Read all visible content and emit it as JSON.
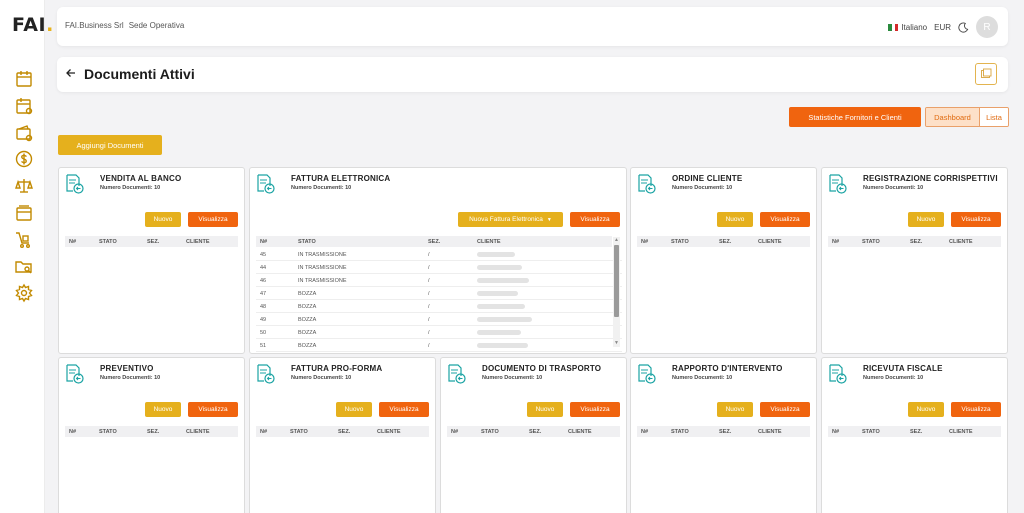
{
  "logo": {
    "text": "FAI",
    "dot": "."
  },
  "topbar": {
    "company": "FAI.Business Srl",
    "location": "Sede Operativa",
    "language": "Italiano",
    "currency": "EUR",
    "avatar_initial": "R"
  },
  "title": {
    "text": "Documenti Attivi"
  },
  "actions": {
    "stats_label": "Statistiche Fornitori e Clienti",
    "dashboard_label": "Dashboard",
    "list_label": "Lista",
    "add_label": "Aggiungi Documenti"
  },
  "labels": {
    "count_prefix": "Numero Documenti: ",
    "nuovo": "Nuovo",
    "visualizza": "Visualizza",
    "nuova_fattura": "Nuova Fattura Elettronica",
    "col_n": "N#",
    "col_stato": "STATO",
    "col_sez": "SEZ.",
    "col_cliente": "CLIENTE"
  },
  "cards": [
    {
      "title": "VENDITA AL BANCO",
      "count": "Numero Documenti: 10"
    },
    {
      "title": "FATTURA ELETTRONICA",
      "count": "Numero Documenti: 10"
    },
    {
      "title": "ORDINE CLIENTE",
      "count": "Numero Documenti: 10"
    },
    {
      "title": "REGISTRAZIONE CORRISPETTIVI",
      "count": "Numero Documenti: 10"
    },
    {
      "title": "PREVENTIVO",
      "count": "Numero Documenti: 10"
    },
    {
      "title": "FATTURA PRO-FORMA",
      "count": "Numero Documenti: 10"
    },
    {
      "title": "DOCUMENTO DI TRASPORTO",
      "count": "Numero Documenti: 10"
    },
    {
      "title": "RAPPORTO D'INTERVENTO",
      "count": "Numero Documenti: 10"
    },
    {
      "title": "RICEVUTA FISCALE",
      "count": "Numero Documenti: 10"
    }
  ],
  "fattura_rows": [
    {
      "n": "45",
      "stato": "IN TRASMISSIONE",
      "sez": "/"
    },
    {
      "n": "44",
      "stato": "IN TRASMISSIONE",
      "sez": "/"
    },
    {
      "n": "46",
      "stato": "IN TRASMISSIONE",
      "sez": "/"
    },
    {
      "n": "47",
      "stato": "BOZZA",
      "sez": "/"
    },
    {
      "n": "48",
      "stato": "BOZZA",
      "sez": "/"
    },
    {
      "n": "49",
      "stato": "BOZZA",
      "sez": "/"
    },
    {
      "n": "50",
      "stato": "BOZZA",
      "sez": "/"
    },
    {
      "n": "51",
      "stato": "BOZZA",
      "sez": "/"
    }
  ],
  "colors": {
    "accent_orange": "#f0640f",
    "accent_yellow": "#e5b01d",
    "icon_teal": "#1aa3a3"
  }
}
